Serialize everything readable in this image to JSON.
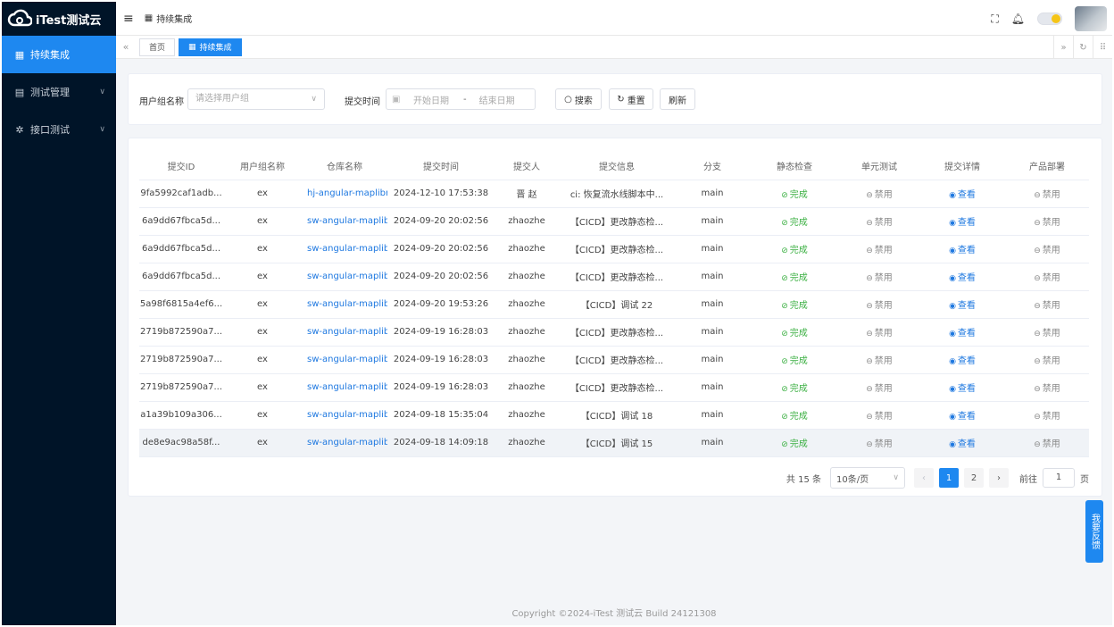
{
  "app": {
    "logo_text": "iTest测试云"
  },
  "sidebar": {
    "items": [
      {
        "label": "持续集成",
        "icon": "grid-icon",
        "active": true
      },
      {
        "label": "测试管理",
        "icon": "document-icon",
        "active": false
      },
      {
        "label": "接口测试",
        "icon": "gear-icon",
        "active": false
      }
    ]
  },
  "header": {
    "breadcrumb": "持续集成"
  },
  "tabs": [
    {
      "label": "首页"
    },
    {
      "label": "持续集成"
    }
  ],
  "filter": {
    "group_label": "用户组名称",
    "group_placeholder": "请选择用户组",
    "time_label": "提交时间",
    "start_placeholder": "开始日期",
    "range_sep": "-",
    "end_placeholder": "结束日期",
    "search_label": "搜索",
    "reset_label": "重置",
    "refresh_label": "刷新"
  },
  "table": {
    "columns": [
      "提交ID",
      "用户组名称",
      "仓库名称",
      "提交时间",
      "提交人",
      "提交信息",
      "分支",
      "静态检查",
      "单元测试",
      "提交详情",
      "产品部署"
    ],
    "rows": [
      {
        "id": "9fa5992caf1adb...",
        "group": "ex",
        "repo": "hj-angular-maplibre",
        "time": "2024-12-10 17:53:38",
        "author": "晋 赵",
        "message": "ci: 恢复流水线脚本中...",
        "branch": "main",
        "static": "完成",
        "unit": "禁用",
        "detail": "查看",
        "deploy": "禁用"
      },
      {
        "id": "6a9dd67fbca5d...",
        "group": "ex",
        "repo": "sw-angular-maplibre",
        "time": "2024-09-20 20:02:56",
        "author": "zhaozhe",
        "message": "【CICD】更改静态检...",
        "branch": "main",
        "static": "完成",
        "unit": "禁用",
        "detail": "查看",
        "deploy": "禁用"
      },
      {
        "id": "6a9dd67fbca5d...",
        "group": "ex",
        "repo": "sw-angular-maplibre",
        "time": "2024-09-20 20:02:56",
        "author": "zhaozhe",
        "message": "【CICD】更改静态检...",
        "branch": "main",
        "static": "完成",
        "unit": "禁用",
        "detail": "查看",
        "deploy": "禁用"
      },
      {
        "id": "6a9dd67fbca5d...",
        "group": "ex",
        "repo": "sw-angular-maplibre",
        "time": "2024-09-20 20:02:56",
        "author": "zhaozhe",
        "message": "【CICD】更改静态检...",
        "branch": "main",
        "static": "完成",
        "unit": "禁用",
        "detail": "查看",
        "deploy": "禁用"
      },
      {
        "id": "5a98f6815a4ef6...",
        "group": "ex",
        "repo": "sw-angular-maplibre",
        "time": "2024-09-20 19:53:26",
        "author": "zhaozhe",
        "message": "【CICD】调试 22",
        "branch": "main",
        "static": "完成",
        "unit": "禁用",
        "detail": "查看",
        "deploy": "禁用"
      },
      {
        "id": "2719b872590a7...",
        "group": "ex",
        "repo": "sw-angular-maplibre",
        "time": "2024-09-19 16:28:03",
        "author": "zhaozhe",
        "message": "【CICD】更改静态检...",
        "branch": "main",
        "static": "完成",
        "unit": "禁用",
        "detail": "查看",
        "deploy": "禁用"
      },
      {
        "id": "2719b872590a7...",
        "group": "ex",
        "repo": "sw-angular-maplibre",
        "time": "2024-09-19 16:28:03",
        "author": "zhaozhe",
        "message": "【CICD】更改静态检...",
        "branch": "main",
        "static": "完成",
        "unit": "禁用",
        "detail": "查看",
        "deploy": "禁用"
      },
      {
        "id": "2719b872590a7...",
        "group": "ex",
        "repo": "sw-angular-maplibre",
        "time": "2024-09-19 16:28:03",
        "author": "zhaozhe",
        "message": "【CICD】更改静态检...",
        "branch": "main",
        "static": "完成",
        "unit": "禁用",
        "detail": "查看",
        "deploy": "禁用"
      },
      {
        "id": "a1a39b109a306...",
        "group": "ex",
        "repo": "sw-angular-maplibre",
        "time": "2024-09-18 15:35:04",
        "author": "zhaozhe",
        "message": "【CICD】调试 18",
        "branch": "main",
        "static": "完成",
        "unit": "禁用",
        "detail": "查看",
        "deploy": "禁用"
      },
      {
        "id": "de8e9ac98a58f...",
        "group": "ex",
        "repo": "sw-angular-maplibre",
        "time": "2024-09-18 14:09:18",
        "author": "zhaozhe",
        "message": "【CICD】调试 15",
        "branch": "main",
        "static": "完成",
        "unit": "禁用",
        "detail": "查看",
        "deploy": "禁用"
      }
    ]
  },
  "pagination": {
    "total": "共 15 条",
    "page_size": "10条/页",
    "pages": [
      "1",
      "2"
    ],
    "current": "1",
    "goto_label": "前往",
    "goto_value": "1",
    "page_unit": "页"
  },
  "footer": {
    "copyright": "Copyright ©2024-iTest 测试云 Build 24121308"
  },
  "feedback": {
    "label": "我要反馈"
  }
}
